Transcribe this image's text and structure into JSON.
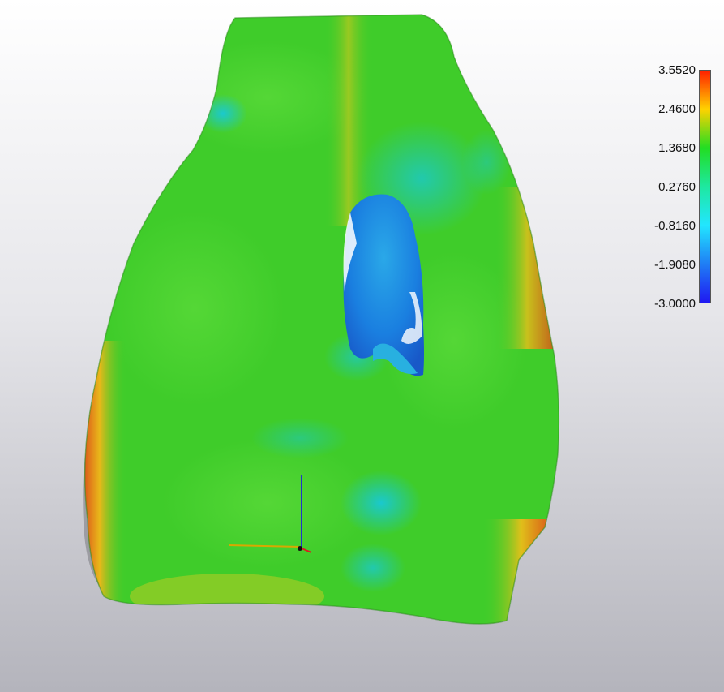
{
  "colorbar": {
    "labels": [
      "3.5520",
      "2.4600",
      "1.3680",
      "0.2760",
      "-0.8160",
      "-1.9080",
      "-3.0000"
    ],
    "max": 3.552,
    "min": -3.0,
    "gradient_colors": [
      "#ff2000",
      "#ffd200",
      "#22dd22",
      "#1ee8a0",
      "#22e6ff",
      "#1f7ef5",
      "#1f18f2"
    ]
  },
  "scene": {
    "description_colors": {
      "body": "#3fcc2a",
      "warm_edge": "#e24a12",
      "cool_spot": "#1ac6d8",
      "hole_inner": "#1a86e0"
    },
    "axes": {
      "x_color": "#d8a800",
      "y_color": "#2233cc",
      "z_color": "#d82020"
    }
  }
}
